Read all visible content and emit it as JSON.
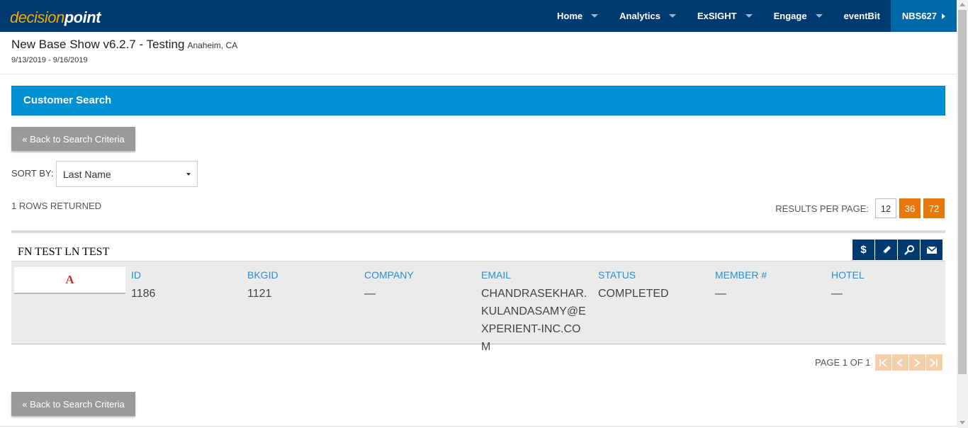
{
  "app": {
    "logo_part1": "decision",
    "logo_part2": "point"
  },
  "nav": {
    "items": [
      {
        "label": "Home"
      },
      {
        "label": "Analytics"
      },
      {
        "label": "ExSIGHT"
      },
      {
        "label": "Engage"
      },
      {
        "label": "eventBit"
      },
      {
        "label": "NBS627"
      }
    ]
  },
  "show": {
    "title": "New Base Show v6.2.7 - Testing",
    "location": "Anaheim, CA",
    "dates": "9/13/2019 - 9/16/2019"
  },
  "panel": {
    "title": "Customer Search"
  },
  "buttons": {
    "back_top": "« Back to Search Criteria",
    "back_bottom": "« Back to Search Criteria"
  },
  "sort": {
    "label": "SORT BY:",
    "selected": "Last Name"
  },
  "results": {
    "rows_returned": "1 ROWS RETURNED",
    "per_page_label": "RESULTS PER PAGE:",
    "per_page_options": [
      "12",
      "36",
      "72"
    ]
  },
  "record": {
    "name": "FN TEST LN TEST",
    "avatar_letter": "A",
    "actions": [
      {
        "icon": "dollar-icon",
        "glyph": "$"
      },
      {
        "icon": "pencil-icon",
        "glyph": "✎"
      },
      {
        "icon": "search-icon",
        "glyph": "🔍"
      },
      {
        "icon": "envelope-icon",
        "glyph": "✉"
      }
    ],
    "fields": [
      {
        "label": "ID",
        "value": "1186"
      },
      {
        "label": "BKGID",
        "value": "1121"
      },
      {
        "label": "COMPANY",
        "value": "—"
      },
      {
        "label": "EMAIL",
        "value": "CHANDRASEKHAR.KULANDASAMY@EXPERIENT-INC.COM"
      },
      {
        "label": "STATUS",
        "value": "COMPLETED"
      },
      {
        "label": "MEMBER #",
        "value": "—"
      },
      {
        "label": "HOTEL",
        "value": "—"
      }
    ]
  },
  "pager": {
    "label": "PAGE 1 OF 1"
  },
  "colors": {
    "topbar": "#003a70",
    "accent": "#0090d4",
    "orange": "#e8780c",
    "label_blue": "#2a8fd0"
  }
}
